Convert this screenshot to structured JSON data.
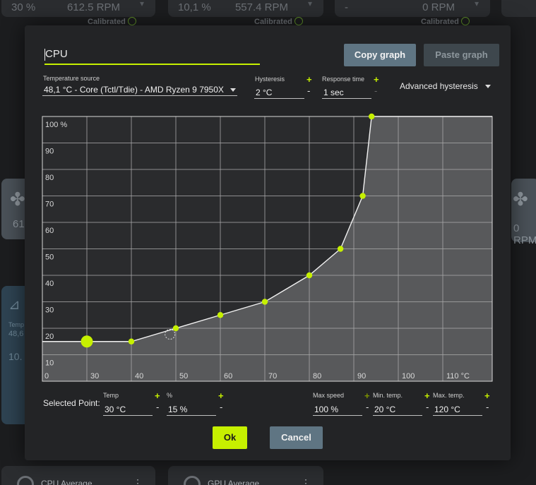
{
  "background": {
    "top_tiles": [
      {
        "value": "30 %",
        "rpm": "612.5 RPM",
        "calibrated": "Calibrated"
      },
      {
        "value": "10,1 %",
        "rpm": "557.4 RPM",
        "calibrated": "Calibrated"
      },
      {
        "value": "-",
        "rpm": "0 RPM",
        "calibrated": "Calibrated"
      }
    ],
    "left_card_rpm": "61",
    "right_card_rpm": "0 RPM",
    "left_card2": {
      "label": "Temp",
      "temp": "48,6",
      "value": "10."
    },
    "bottom_tiles": [
      {
        "label": "CPU Average"
      },
      {
        "label": "GPU Average"
      }
    ]
  },
  "dialog": {
    "name": "CPU",
    "copy_graph": "Copy graph",
    "paste_graph": "Paste graph",
    "temperature_source_label": "Temperature source",
    "temperature_source_value": "48,1 °C - Core (Tctl/Tdie) - AMD Ryzen 9 7950X",
    "hysteresis_label": "Hysteresis",
    "hysteresis_value": "2 °C",
    "response_time_label": "Response time",
    "response_time_value": "1 sec",
    "advanced_hysteresis": "Advanced hysteresis",
    "selected_point_label": "Selected Point:",
    "temp_label": "Temp",
    "temp_value": "30 °C",
    "percent_label": "%",
    "percent_value": "15 %",
    "max_speed_label": "Max speed",
    "max_speed_value": "100 %",
    "min_temp_label": "Min. temp.",
    "min_temp_value": "20 °C",
    "max_temp_label": "Max. temp.",
    "max_temp_value": "120 °C",
    "ok": "Ok",
    "cancel": "Cancel"
  },
  "chart_data": {
    "type": "line",
    "title": "",
    "xlabel": "",
    "ylabel": "",
    "xlim": [
      20,
      120
    ],
    "ylim": [
      0,
      100
    ],
    "x_ticks": [
      "0",
      "30",
      "40",
      "50",
      "60",
      "70",
      "80",
      "90",
      "100",
      "110 °C"
    ],
    "y_ticks": [
      "10",
      "20",
      "30",
      "40",
      "50",
      "60",
      "70",
      "80",
      "90",
      "100 %"
    ],
    "series": [
      {
        "points": [
          {
            "x": 20,
            "y": 15
          },
          {
            "x": 30,
            "y": 15
          },
          {
            "x": 40,
            "y": 15
          },
          {
            "x": 50,
            "y": 20
          },
          {
            "x": 60,
            "y": 25
          },
          {
            "x": 70,
            "y": 30
          },
          {
            "x": 80,
            "y": 40
          },
          {
            "x": 87,
            "y": 50
          },
          {
            "x": 92,
            "y": 70
          },
          {
            "x": 94,
            "y": 100
          },
          {
            "x": 120,
            "y": 100
          }
        ]
      }
    ],
    "visible_points": [
      30,
      40,
      50,
      60,
      70,
      80,
      87,
      92,
      94
    ],
    "selected_point": {
      "x": 30,
      "y": 15
    },
    "hover_point": {
      "x": 49,
      "y": 18
    },
    "grid": true,
    "colors": {
      "line": "#f2f2f2",
      "point": "#c6f000",
      "fill": "#58595b",
      "bg": "#2a2b2d",
      "grid": "#a8a8a8"
    }
  }
}
